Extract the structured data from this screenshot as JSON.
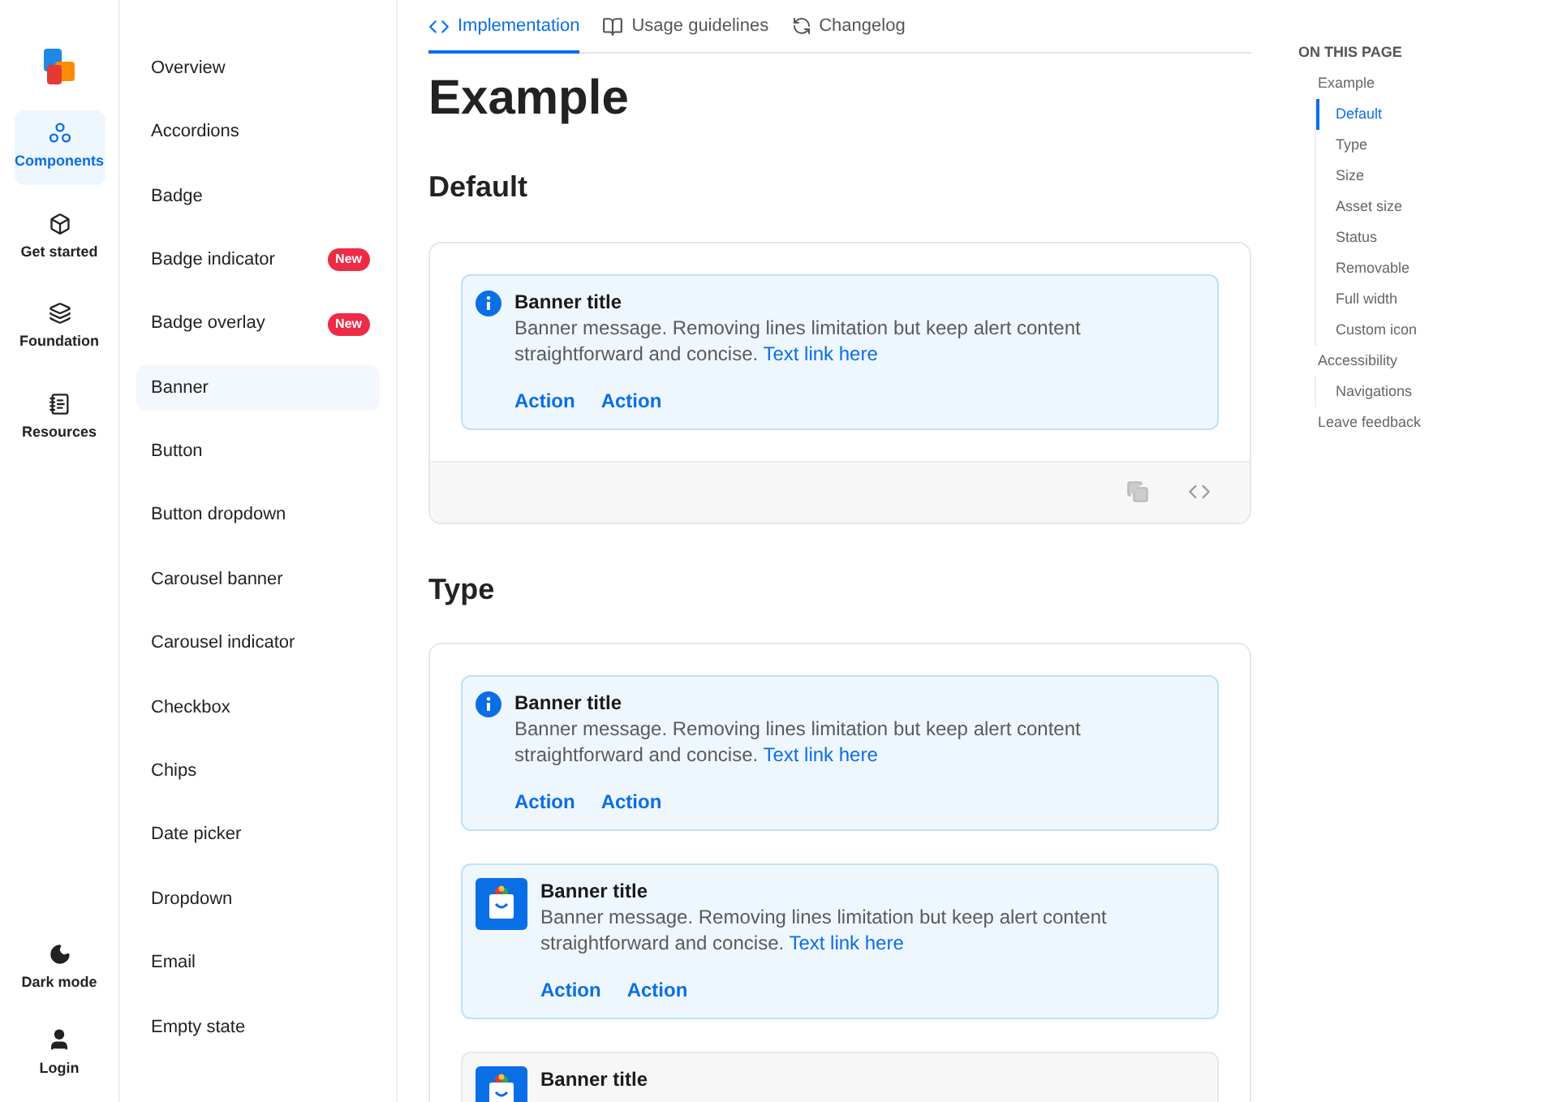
{
  "rail": {
    "items": [
      {
        "label": "Components",
        "selected": true,
        "kind": "components"
      },
      {
        "label": "Get started",
        "selected": false,
        "kind": "cube"
      },
      {
        "label": "Foundation",
        "selected": false,
        "kind": "layers"
      },
      {
        "label": "Resources",
        "selected": false,
        "kind": "resources"
      }
    ],
    "bottom": [
      {
        "label": "Dark mode",
        "kind": "moon"
      },
      {
        "label": "Login",
        "kind": "user"
      }
    ]
  },
  "nav": {
    "items": [
      {
        "label": "Overview",
        "selected": false
      },
      {
        "label": "Accordions",
        "selected": false
      },
      {
        "label": "Badge",
        "selected": false
      },
      {
        "label": "Badge indicator",
        "selected": false,
        "badge": "New"
      },
      {
        "label": "Badge overlay",
        "selected": false,
        "badge": "New"
      },
      {
        "label": "Banner",
        "selected": true
      },
      {
        "label": "Button",
        "selected": false
      },
      {
        "label": "Button dropdown",
        "selected": false
      },
      {
        "label": "Carousel banner",
        "selected": false
      },
      {
        "label": "Carousel indicator",
        "selected": false
      },
      {
        "label": "Checkbox",
        "selected": false
      },
      {
        "label": "Chips",
        "selected": false
      },
      {
        "label": "Date picker",
        "selected": false
      },
      {
        "label": "Dropdown",
        "selected": false
      },
      {
        "label": "Email",
        "selected": false
      },
      {
        "label": "Empty state",
        "selected": false
      }
    ]
  },
  "tabs": [
    {
      "label": "Implementation",
      "selected": true,
      "kind": "code"
    },
    {
      "label": "Usage guidelines",
      "selected": false,
      "kind": "book"
    },
    {
      "label": "Changelog",
      "selected": false,
      "kind": "cycle"
    }
  ],
  "page_title": "Example",
  "sections": [
    {
      "heading": "Default",
      "footer": true,
      "banners": [
        {
          "kind": "info",
          "title": "Banner title",
          "message": "Banner message. Removing lines limitation but keep alert content straightforward and concise.",
          "link": "Text link here",
          "actions": [
            "Action",
            "Action"
          ]
        }
      ]
    },
    {
      "heading": "Type",
      "footer": false,
      "banners": [
        {
          "kind": "info",
          "title": "Banner title",
          "message": "Banner message. Removing lines limitation but keep alert content straightforward and concise.",
          "link": "Text link here",
          "actions": [
            "Action",
            "Action"
          ]
        },
        {
          "kind": "app",
          "title": "Banner title",
          "message": "Banner message. Removing lines limitation but keep alert content straightforward and concise.",
          "link": "Text link here",
          "actions": [
            "Action",
            "Action"
          ]
        },
        {
          "kind": "neutral",
          "title": "Banner title"
        }
      ]
    }
  ],
  "toc": {
    "heading": "ON THIS PAGE",
    "items": [
      {
        "label": "Example",
        "selected": false,
        "children": [
          {
            "label": "Default",
            "selected": true
          },
          {
            "label": "Type",
            "selected": false
          },
          {
            "label": "Size",
            "selected": false
          },
          {
            "label": "Asset size",
            "selected": false
          },
          {
            "label": "Status",
            "selected": false
          },
          {
            "label": "Removable",
            "selected": false
          },
          {
            "label": "Full width",
            "selected": false
          },
          {
            "label": "Custom icon",
            "selected": false
          }
        ]
      },
      {
        "label": "Accessibility",
        "selected": false,
        "children": [
          {
            "label": "Navigations",
            "selected": false
          }
        ]
      },
      {
        "label": "Leave feedback",
        "selected": false
      }
    ]
  }
}
